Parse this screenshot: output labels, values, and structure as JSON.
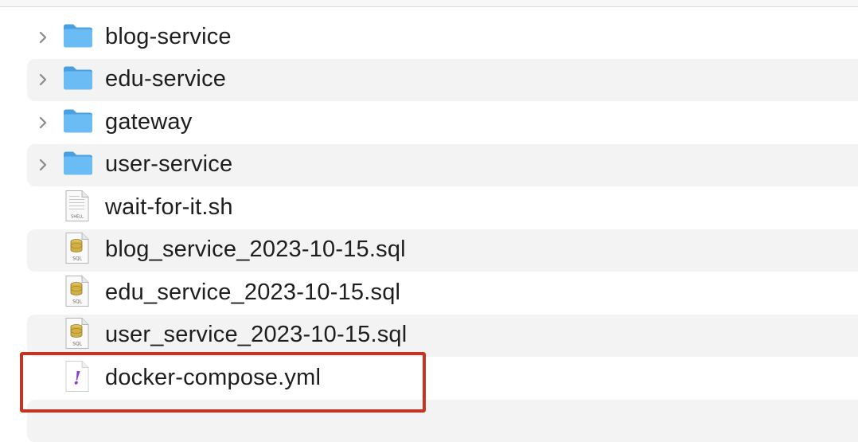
{
  "files": [
    {
      "name": "blog-service",
      "kind": "folder",
      "icon": "folder-icon",
      "expandable": true
    },
    {
      "name": "edu-service",
      "kind": "folder",
      "icon": "folder-icon",
      "expandable": true
    },
    {
      "name": "gateway",
      "kind": "folder",
      "icon": "folder-icon",
      "expandable": true
    },
    {
      "name": "user-service",
      "kind": "folder",
      "icon": "folder-icon",
      "expandable": true
    },
    {
      "name": "wait-for-it.sh",
      "kind": "shell-script",
      "icon": "shell-script-icon",
      "icon_text": "SHELL",
      "expandable": false
    },
    {
      "name": "blog_service_2023-10-15.sql",
      "kind": "sql",
      "icon": "sql-file-icon",
      "icon_text": "SQL",
      "expandable": false
    },
    {
      "name": "edu_service_2023-10-15.sql",
      "kind": "sql",
      "icon": "sql-file-icon",
      "icon_text": "SQL",
      "expandable": false
    },
    {
      "name": "user_service_2023-10-15.sql",
      "kind": "sql",
      "icon": "sql-file-icon",
      "icon_text": "SQL",
      "expandable": false
    },
    {
      "name": "docker-compose.yml",
      "kind": "yaml",
      "icon": "yaml-file-icon",
      "icon_text": "!",
      "expandable": false,
      "highlighted": true
    }
  ],
  "colors": {
    "highlight_border": "#c63224",
    "folder": "#5fb4f0",
    "row_stripe": "#f3f3f3"
  }
}
